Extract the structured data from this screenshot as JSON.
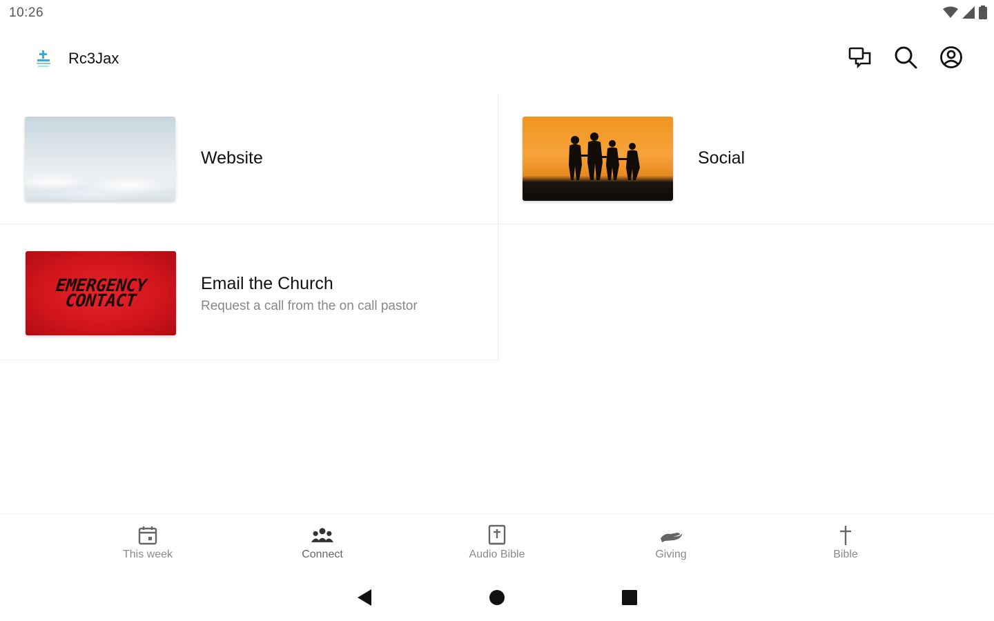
{
  "status_bar": {
    "time": "10:26",
    "icons": [
      "wifi-icon",
      "cell-signal-icon",
      "battery-icon"
    ]
  },
  "app_bar": {
    "title": "Rc3Jax",
    "logo": "church-logo",
    "actions": [
      "chat-icon",
      "search-icon",
      "account-icon"
    ]
  },
  "cards": {
    "website": {
      "title": "Website",
      "image": "clouds-sky"
    },
    "social": {
      "title": "Social",
      "image": "family-sunset-silhouette"
    },
    "email": {
      "title": "Email the Church",
      "subtitle": "Request a call from the on call pastor",
      "image_text_line1": "EMERGENCY",
      "image_text_line2": "CONTACT"
    }
  },
  "bottom_nav": {
    "items": [
      {
        "label": "This week",
        "icon": "calendar-icon"
      },
      {
        "label": "Connect",
        "icon": "people-icon"
      },
      {
        "label": "Audio Bible",
        "icon": "book-icon"
      },
      {
        "label": "Giving",
        "icon": "giving-hand-icon"
      },
      {
        "label": "Bible",
        "icon": "cross-icon"
      }
    ],
    "active": "Connect"
  },
  "system_nav": [
    "back-icon",
    "home-icon",
    "recents-icon"
  ],
  "colors": {
    "emergency_red": "#d0141c",
    "sunset_orange": "#f6a33a",
    "text_primary": "#111111",
    "text_secondary": "#888888"
  }
}
